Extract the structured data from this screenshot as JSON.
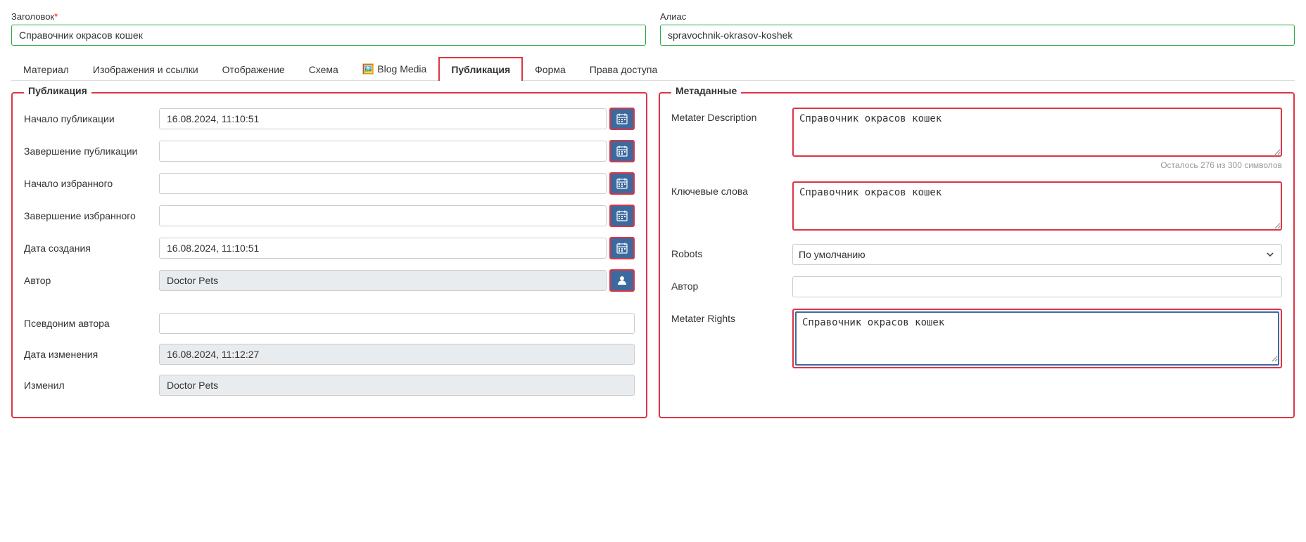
{
  "header": {
    "title_label": "Заголовок",
    "title_required": "*",
    "title_value": "Справочник окрасов кошек",
    "alias_label": "Алиас",
    "alias_value": "spravochnik-okrasov-koshek"
  },
  "tabs": {
    "items": [
      {
        "label": "Материал",
        "active": false,
        "icon": ""
      },
      {
        "label": "Изображения и ссылки",
        "active": false,
        "icon": ""
      },
      {
        "label": "Отображение",
        "active": false,
        "icon": ""
      },
      {
        "label": "Схема",
        "active": false,
        "icon": ""
      },
      {
        "label": "Blog Media",
        "active": false,
        "icon": "🖼️"
      },
      {
        "label": "Публикация",
        "active": true,
        "icon": ""
      },
      {
        "label": "Форма",
        "active": false,
        "icon": ""
      },
      {
        "label": "Права доступа",
        "active": false,
        "icon": ""
      }
    ]
  },
  "publication_panel": {
    "legend": "Публикация",
    "fields": [
      {
        "label": "Начало публикации",
        "value": "16.08.2024, 11:10:51",
        "readonly": false,
        "has_calendar": true,
        "has_person": false
      },
      {
        "label": "Завершение публикации",
        "value": "",
        "readonly": false,
        "has_calendar": true,
        "has_person": false
      },
      {
        "label": "Начало избранного",
        "value": "",
        "readonly": false,
        "has_calendar": true,
        "has_person": false
      },
      {
        "label": "Завершение избранного",
        "value": "",
        "readonly": false,
        "has_calendar": true,
        "has_person": false
      },
      {
        "label": "Дата создания",
        "value": "16.08.2024, 11:10:51",
        "readonly": false,
        "has_calendar": true,
        "has_person": false
      },
      {
        "label": "Автор",
        "value": "Doctor Pets",
        "readonly": true,
        "has_calendar": false,
        "has_person": true
      }
    ],
    "below_fields": [
      {
        "label": "Псевдоним автора",
        "value": "",
        "readonly": false
      },
      {
        "label": "Дата изменения",
        "value": "16.08.2024, 11:12:27",
        "readonly": true
      },
      {
        "label": "Изменил",
        "value": "Doctor Pets",
        "readonly": true
      }
    ]
  },
  "metadata_panel": {
    "legend": "Метаданные",
    "fields": [
      {
        "label": "Metater Description",
        "type": "textarea",
        "value": "Справочник окрасов кошек",
        "char_count": "Осталось 276 из 300 символов",
        "bordered_red": true
      },
      {
        "label": "Ключевые слова",
        "type": "textarea",
        "value": "Справочник окрасов кошек",
        "char_count": "",
        "bordered_red": true
      },
      {
        "label": "Robots",
        "type": "select",
        "value": "По умолчанию",
        "options": [
          "По умолчанию"
        ],
        "bordered_red": false
      },
      {
        "label": "Автор",
        "type": "input",
        "value": "",
        "bordered_red": false
      },
      {
        "label": "Metater Rights",
        "type": "textarea_focused",
        "value": "Справочник окрасов кошек",
        "char_count": "",
        "bordered_red": true
      }
    ]
  }
}
